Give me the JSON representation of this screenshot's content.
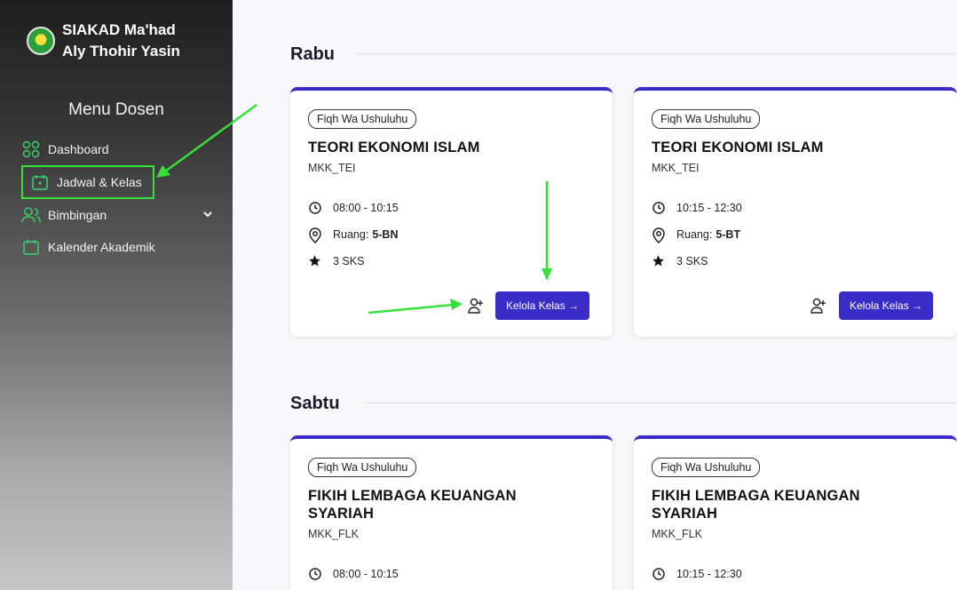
{
  "sidebar": {
    "brand_line1": "SIAKAD Ma'had",
    "brand_line2": "Aly Thohir Yasin",
    "menu_title": "Menu Dosen",
    "items": [
      {
        "label": "Dashboard",
        "icon": "grid-icon"
      },
      {
        "label": "Jadwal & Kelas",
        "icon": "calendar-icon",
        "active": true
      },
      {
        "label": "Bimbingan",
        "icon": "users-icon",
        "has_submenu": true
      },
      {
        "label": "Kalender Akademik",
        "icon": "calendar-icon"
      }
    ]
  },
  "sections": [
    {
      "day": "Rabu",
      "cards": [
        {
          "badge": "Fiqh Wa Ushuluhu",
          "title": "TEORI EKONOMI ISLAM",
          "code": "MKK_TEI",
          "time": "08:00 - 10:15",
          "room_label": "Ruang:",
          "room": "5-BN",
          "sks": "3 SKS",
          "button": "Kelola Kelas →"
        },
        {
          "badge": "Fiqh Wa Ushuluhu",
          "title": "TEORI EKONOMI ISLAM",
          "code": "MKK_TEI",
          "time": "10:15 - 12:30",
          "room_label": "Ruang:",
          "room": "5-BT",
          "sks": "3 SKS",
          "button": "Kelola Kelas →"
        }
      ]
    },
    {
      "day": "Sabtu",
      "cards": [
        {
          "badge": "Fiqh Wa Ushuluhu",
          "title": "FIKIH LEMBAGA KEUANGAN SYARIAH",
          "code": "MKK_FLK",
          "time": "08:00 - 10:15"
        },
        {
          "badge": "Fiqh Wa Ushuluhu",
          "title": "FIKIH LEMBAGA KEUANGAN SYARIAH",
          "code": "MKK_FLK",
          "time": "10:15 - 12:30"
        }
      ]
    }
  ],
  "colors": {
    "accent": "#3a2cc7",
    "annotation": "#35e13a"
  }
}
